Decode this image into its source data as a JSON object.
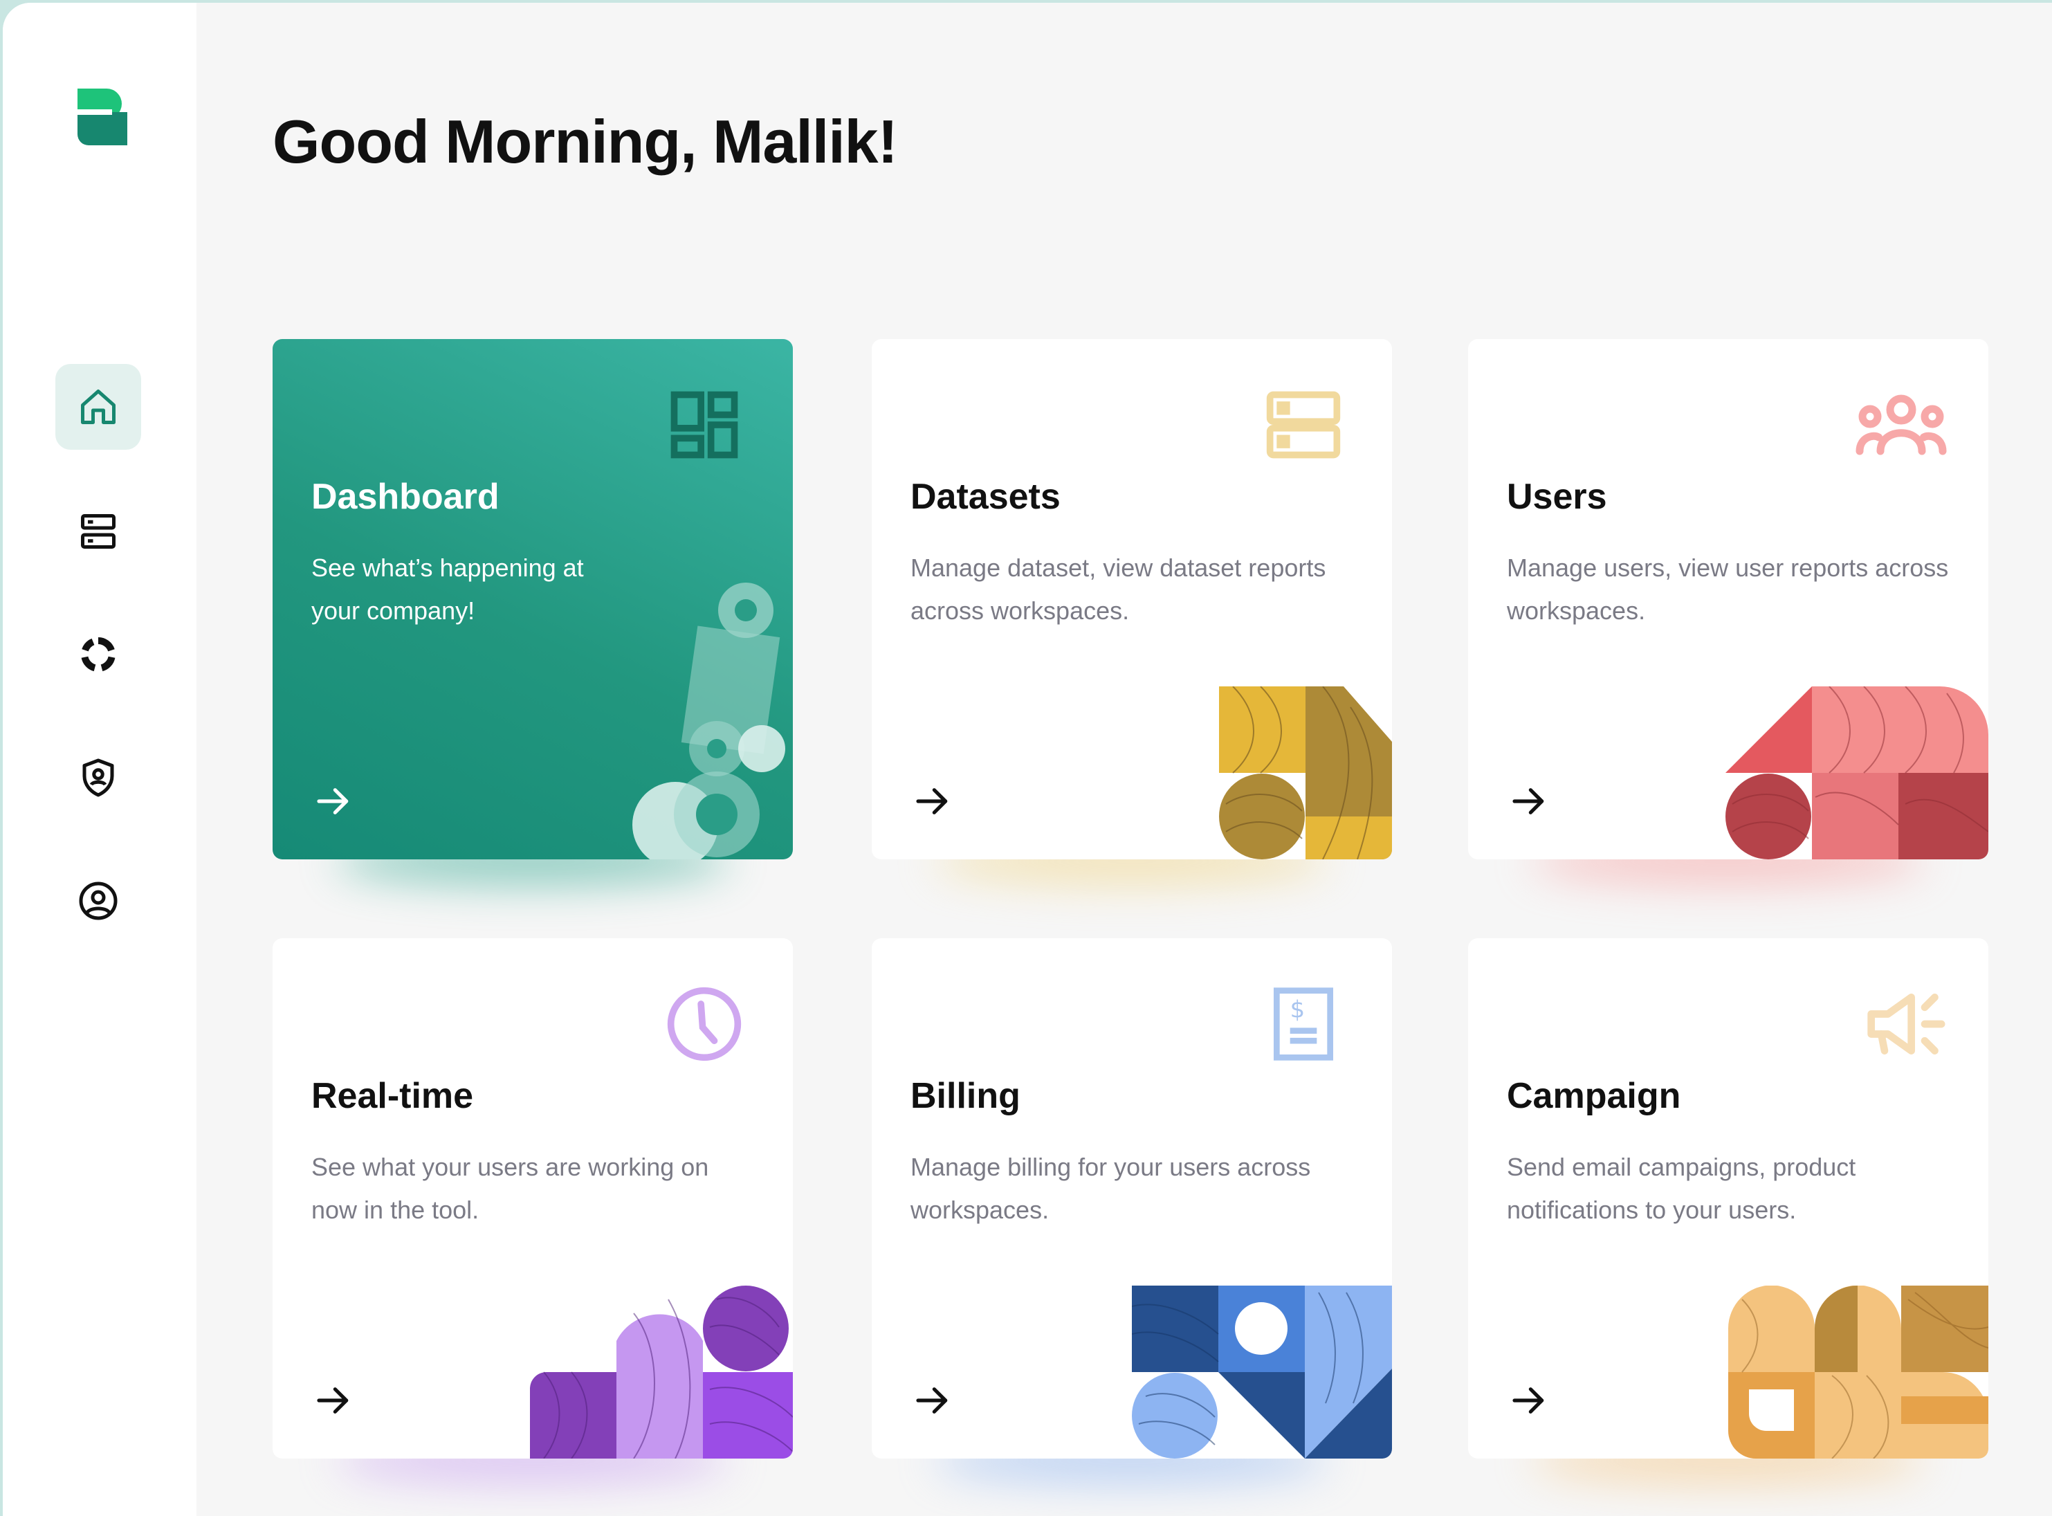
{
  "greeting": "Good Morning, Mallik!",
  "sidebar": {
    "items": [
      {
        "icon": "home-icon",
        "active": true
      },
      {
        "icon": "datasets-icon",
        "active": false
      },
      {
        "icon": "analytics-icon",
        "active": false
      },
      {
        "icon": "shield-icon",
        "active": false
      },
      {
        "icon": "user-circle-icon",
        "active": false
      }
    ]
  },
  "cards": [
    {
      "title": "Dashboard",
      "desc": "See what’s happening at your company!",
      "icon": "dashboard-grid-icon",
      "accent": "#22977f"
    },
    {
      "title": "Datasets",
      "desc": "Manage dataset, view dataset reports across workspaces.",
      "icon": "server-icon",
      "accent": "#e8b93c"
    },
    {
      "title": "Users",
      "desc": "Manage users, view user reports across workspaces.",
      "icon": "users-group-icon",
      "accent": "#f48e8e"
    },
    {
      "title": "Real-time",
      "desc": "See what your users are working on now in the tool.",
      "icon": "clock-icon",
      "accent": "#a066e0"
    },
    {
      "title": "Billing",
      "desc": "Manage billing for your users across workspaces.",
      "icon": "invoice-icon",
      "accent": "#5b8fe8"
    },
    {
      "title": "Campaign",
      "desc": "Send email campaigns, product notifications to your users.",
      "icon": "megaphone-icon",
      "accent": "#f0b867"
    }
  ],
  "colors": {
    "brand": "#1ec37a",
    "teal": "#22977f",
    "background": "#f6f6f6",
    "text_muted": "#7a7a85"
  }
}
